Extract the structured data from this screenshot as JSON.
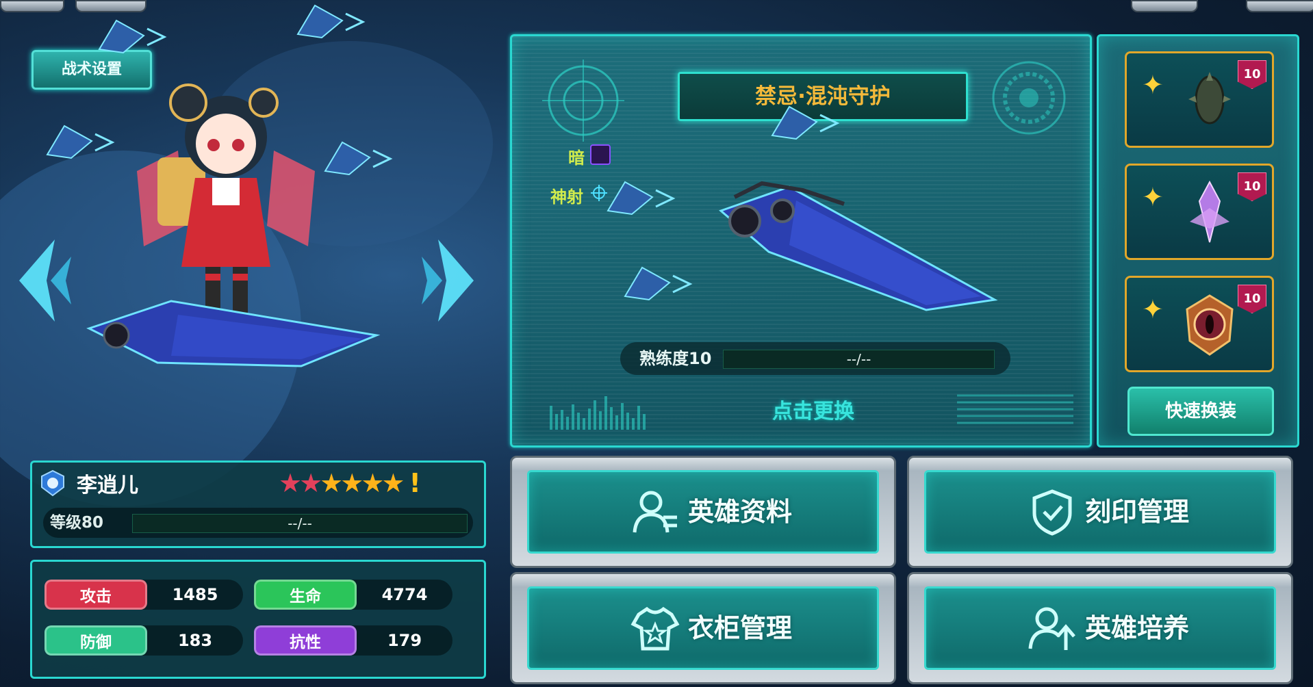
{
  "tactic_button": "战术设置",
  "weapon": {
    "name": "禁忌·混沌守护",
    "element": "暗",
    "skill": "神射",
    "proficiency_label": "熟练度10",
    "proficiency_value": "--/--",
    "change_label": "点击更换"
  },
  "equipment": {
    "slots": [
      {
        "level": "10",
        "icon": "spiked-shell-icon"
      },
      {
        "level": "10",
        "icon": "crystal-wing-icon"
      },
      {
        "level": "10",
        "icon": "eye-emblem-icon"
      }
    ],
    "quick_equip_label": "快速换装"
  },
  "hero": {
    "name": "李逍儿",
    "level_label": "等级80",
    "level_value": "--/--",
    "stars_filled": 6,
    "stars_red": 2,
    "alert": "!"
  },
  "stats": [
    {
      "label": "攻击",
      "value": "1485",
      "color": "#d8334b"
    },
    {
      "label": "生命",
      "value": "4774",
      "color": "#2bc55a"
    },
    {
      "label": "防御",
      "value": "183",
      "color": "#2bc289"
    },
    {
      "label": "抗性",
      "value": "179",
      "color": "#8f3ed8"
    }
  ],
  "actions": [
    {
      "label": "英雄资料",
      "icon": "user-icon"
    },
    {
      "label": "刻印管理",
      "icon": "shield-swap-icon"
    },
    {
      "label": "衣柜管理",
      "icon": "shirt-icon"
    },
    {
      "label": "英雄培养",
      "icon": "user-upgrade-icon"
    }
  ]
}
